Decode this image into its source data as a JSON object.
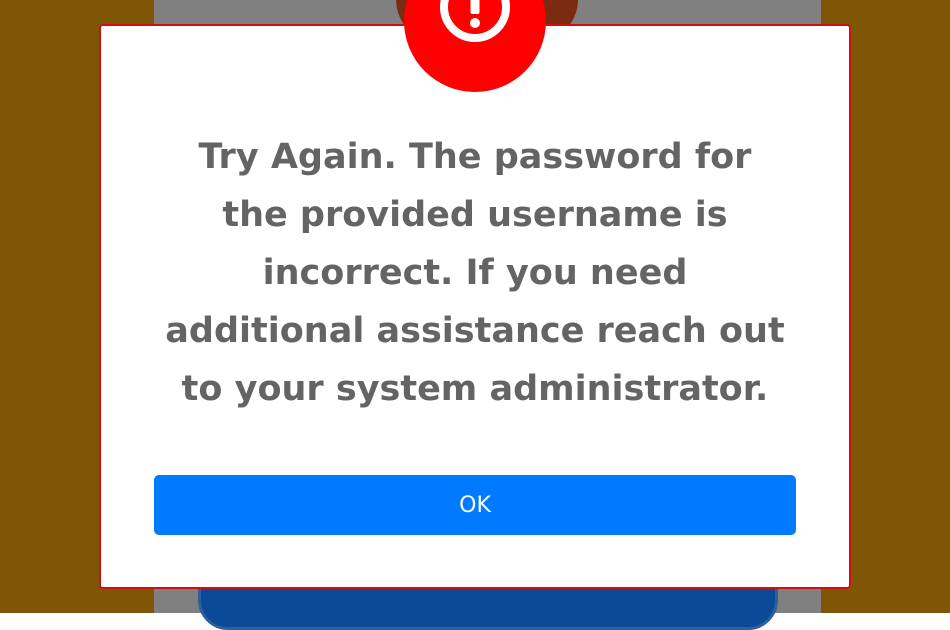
{
  "dialog": {
    "icon": "exclamation-circle-icon",
    "message": "Try Again. The password for the provided username is incorrect. If you need additional assistance reach out to your system administrator.",
    "ok_label": "OK"
  },
  "colors": {
    "backdrop": "#7f5506",
    "alert_red": "#ff0000",
    "dialog_border": "#d01010",
    "button_blue": "#007bff",
    "message_text": "#646464"
  }
}
